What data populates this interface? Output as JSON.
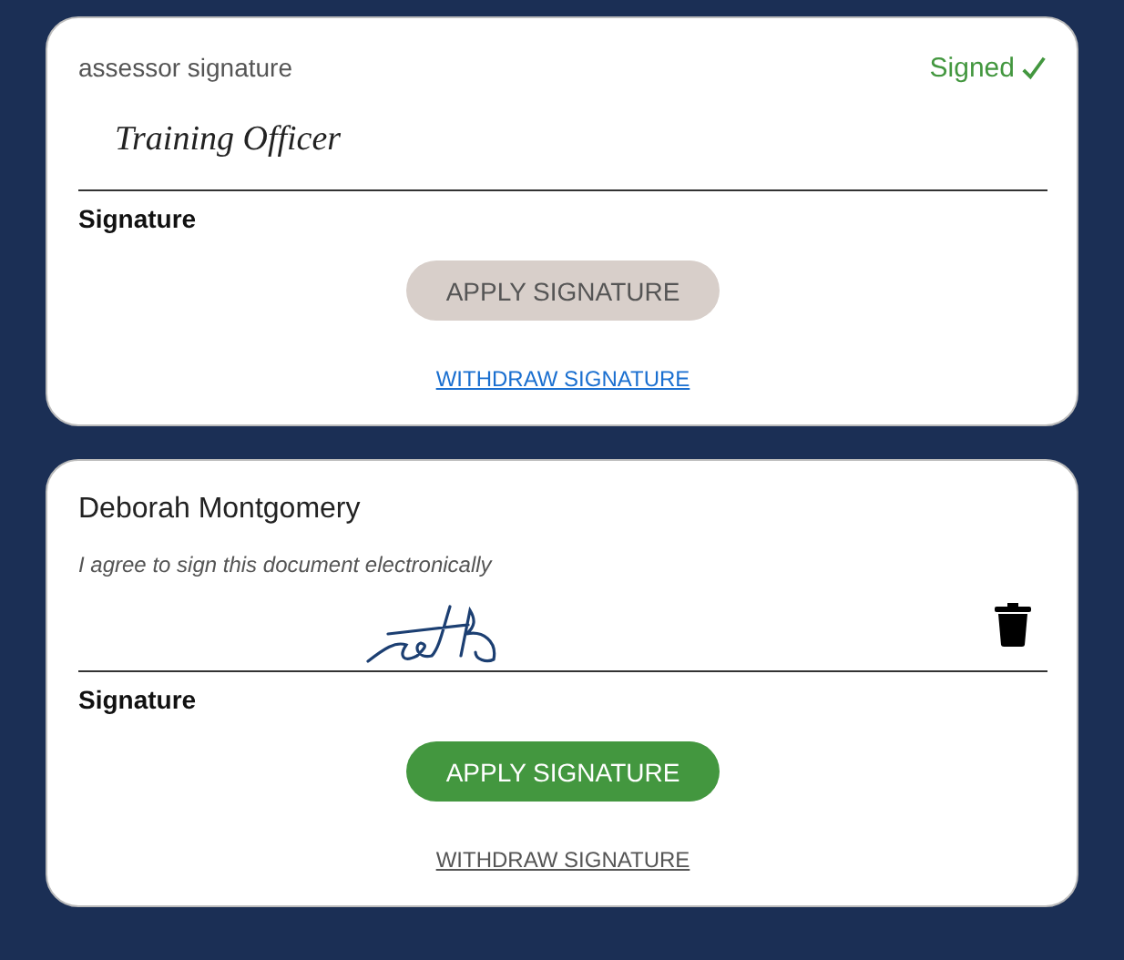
{
  "cards": [
    {
      "title": "assessor signature",
      "title_muted": true,
      "signed": true,
      "status": "Signed",
      "signature": {
        "kind": "typed",
        "text": "Training Officer"
      },
      "deletable": false,
      "signature_label": "Signature",
      "apply": {
        "label": "APPLY SIGNATURE",
        "disabled": true
      },
      "withdraw": {
        "label": "WITHDRAW SIGNATURE",
        "disabled": false
      }
    },
    {
      "title": "Deborah Montgomery",
      "title_muted": false,
      "signed": false,
      "consent": "I agree to sign this document electronically",
      "signature": {
        "kind": "drawn"
      },
      "deletable": true,
      "signature_label": "Signature",
      "apply": {
        "label": "APPLY SIGNATURE",
        "disabled": false
      },
      "withdraw": {
        "label": "WITHDRAW SIGNATURE",
        "disabled": true
      }
    }
  ]
}
